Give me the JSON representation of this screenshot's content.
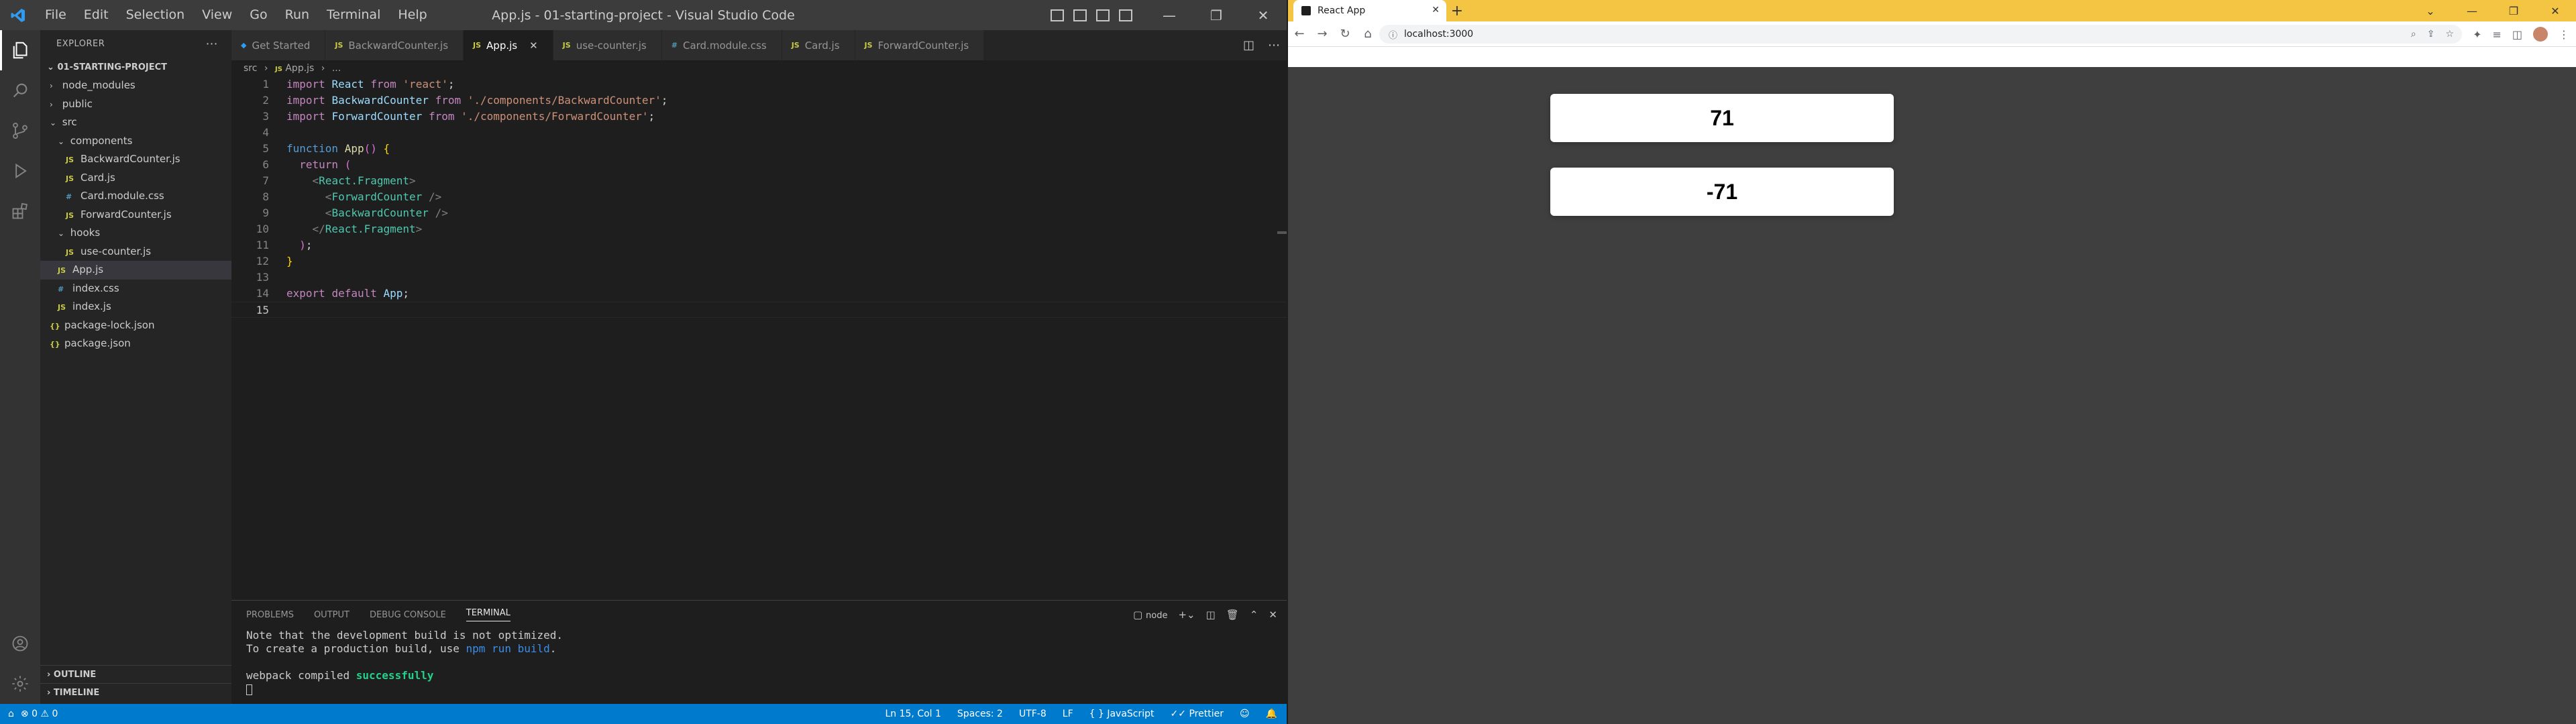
{
  "vscode": {
    "menu": [
      "File",
      "Edit",
      "Selection",
      "View",
      "Go",
      "Run",
      "Terminal",
      "Help"
    ],
    "window_title": "App.js - 01-starting-project - Visual Studio Code",
    "sidebar": {
      "title": "EXPLORER",
      "project": "01-STARTING-PROJECT",
      "items": [
        {
          "label": "node_modules",
          "type": "folder",
          "expanded": false,
          "depth": 1
        },
        {
          "label": "public",
          "type": "folder",
          "expanded": false,
          "depth": 1
        },
        {
          "label": "src",
          "type": "folder",
          "expanded": true,
          "depth": 1
        },
        {
          "label": "components",
          "type": "folder",
          "expanded": true,
          "depth": 2
        },
        {
          "label": "BackwardCounter.js",
          "type": "js",
          "depth": 3
        },
        {
          "label": "Card.js",
          "type": "js",
          "depth": 3
        },
        {
          "label": "Card.module.css",
          "type": "css",
          "depth": 3
        },
        {
          "label": "ForwardCounter.js",
          "type": "js",
          "depth": 3
        },
        {
          "label": "hooks",
          "type": "folder",
          "expanded": true,
          "depth": 2
        },
        {
          "label": "use-counter.js",
          "type": "js",
          "depth": 3
        },
        {
          "label": "App.js",
          "type": "js",
          "depth": 2,
          "selected": true
        },
        {
          "label": "index.css",
          "type": "css",
          "depth": 2
        },
        {
          "label": "index.js",
          "type": "js",
          "depth": 2
        },
        {
          "label": "package-lock.json",
          "type": "json",
          "depth": 1
        },
        {
          "label": "package.json",
          "type": "json",
          "depth": 1
        }
      ],
      "outline": "OUTLINE",
      "timeline": "TIMELINE"
    },
    "tabs": [
      {
        "label": "Get Started",
        "icon": "vscode-icon",
        "active": false
      },
      {
        "label": "BackwardCounter.js",
        "icon": "JS",
        "active": false
      },
      {
        "label": "App.js",
        "icon": "JS",
        "active": true
      },
      {
        "label": "use-counter.js",
        "icon": "JS",
        "active": false
      },
      {
        "label": "Card.module.css",
        "icon": "#",
        "active": false
      },
      {
        "label": "Card.js",
        "icon": "JS",
        "active": false
      },
      {
        "label": "ForwardCounter.js",
        "icon": "JS",
        "active": false
      }
    ],
    "breadcrumb": [
      "src",
      "App.js",
      "..."
    ],
    "code_lines": [
      "import React from 'react';",
      "import BackwardCounter from './components/BackwardCounter';",
      "import ForwardCounter from './components/ForwardCounter';",
      "",
      "function App() {",
      "  return (",
      "    <React.Fragment>",
      "      <ForwardCounter />",
      "      <BackwardCounter />",
      "    </React.Fragment>",
      "  );",
      "}",
      "",
      "export default App;",
      ""
    ],
    "current_line": 15,
    "panel": {
      "tabs": [
        "PROBLEMS",
        "OUTPUT",
        "DEBUG CONSOLE",
        "TERMINAL"
      ],
      "active_tab": "TERMINAL",
      "terminal_name": "node",
      "terminal_lines": {
        "l1": "Note that the development build is not optimized.",
        "l2_pre": "To create a production build, use ",
        "l2_cmd": "npm run build",
        "l2_post": ".",
        "l3_pre": "webpack compiled ",
        "l3_ok": "successfully"
      }
    },
    "status": {
      "errors": "0",
      "warnings": "0",
      "position": "Ln 15, Col 1",
      "spaces": "Spaces: 2",
      "encoding": "UTF-8",
      "eol": "LF",
      "language": "JavaScript",
      "formatter": "Prettier"
    }
  },
  "browser": {
    "tab_title": "React App",
    "url": "localhost:3000",
    "cards": [
      "71",
      "-71"
    ]
  },
  "colors": {
    "vscode_accent": "#007acc",
    "browser_tabbar": "#f4c542",
    "page_background": "#3f3f3f"
  }
}
